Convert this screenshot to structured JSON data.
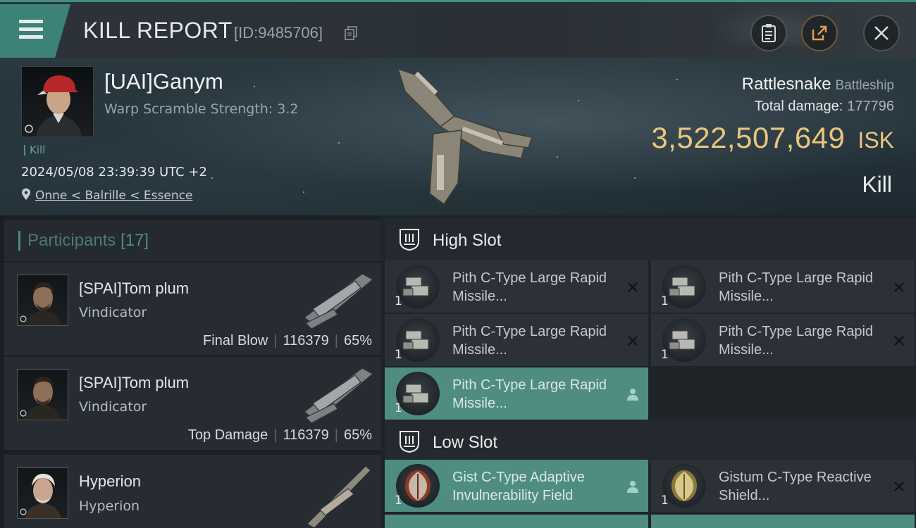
{
  "header": {
    "title": "KILL REPORT",
    "report_id": "[ID:9485706]"
  },
  "victim": {
    "pilot": "[UAI]Ganym",
    "warp_scramble": "Warp Scramble Strength: 3.2",
    "tag": "Kill",
    "timestamp": "2024/05/08 23:39:39 UTC +2",
    "location": "Onne < Balrille < Essence",
    "ship": "Rattlesnake",
    "ship_class": "Battleship",
    "total_damage_label": "Total damage:",
    "total_damage": "177796",
    "isk_value": "3,522,507,649",
    "isk_unit": "ISK",
    "result": "Kill"
  },
  "participants": {
    "label": "Participants",
    "count": "[17]",
    "rows": [
      {
        "name": "[SPAI]Tom plum",
        "ship": "Vindicator",
        "role": "Final Blow",
        "damage": "116379",
        "percent": "65%"
      },
      {
        "name": "[SPAI]Tom plum",
        "ship": "Vindicator",
        "role": "Top Damage",
        "damage": "116379",
        "percent": "65%"
      },
      {
        "name": "Hyperion",
        "ship": "Hyperion",
        "role": "",
        "damage": "",
        "percent": ""
      }
    ]
  },
  "high_slot": {
    "label": "High Slot",
    "modules": [
      {
        "name": "Pith C-Type Large Rapid Missile...",
        "qty": "1",
        "status": "destroyed"
      },
      {
        "name": "Pith C-Type Large Rapid Missile...",
        "qty": "1",
        "status": "destroyed"
      },
      {
        "name": "Pith C-Type Large Rapid Missile...",
        "qty": "1",
        "status": "destroyed"
      },
      {
        "name": "Pith C-Type Large Rapid Missile...",
        "qty": "1",
        "status": "destroyed"
      },
      {
        "name": "Pith C-Type Large Rapid Missile...",
        "qty": "1",
        "status": "dropped"
      }
    ]
  },
  "low_slot": {
    "label": "Low Slot",
    "modules": [
      {
        "name": "Gist C-Type Adaptive Invulnerability Field",
        "qty": "1",
        "status": "dropped"
      },
      {
        "name": "Gistum C-Type Reactive Shield...",
        "qty": "1",
        "status": "destroyed"
      }
    ]
  },
  "colors": {
    "accent": "#4f8d83",
    "isk": "#e8c67d",
    "background": "#1c2126"
  },
  "icons": {
    "menu": "hamburger-icon",
    "copy": "copy-icon",
    "clipboard": "clipboard-icon",
    "share": "share-icon",
    "close": "close-icon",
    "location": "location-pin-icon",
    "slot": "shield-slot-icon",
    "destroyed": "x-icon",
    "dropped": "person-icon"
  }
}
